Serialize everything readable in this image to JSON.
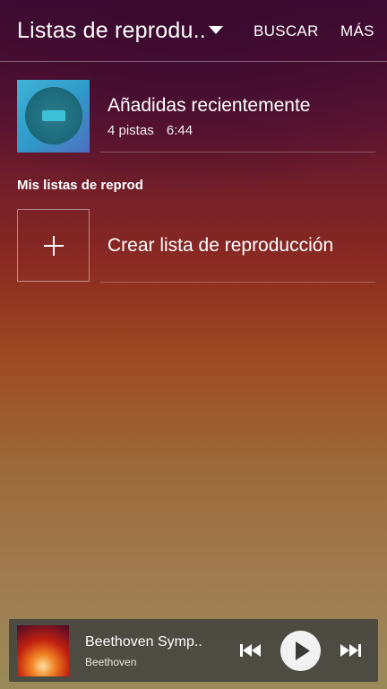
{
  "header": {
    "title": "Listas de reprodu..",
    "actions": [
      "BUSCAR",
      "MÁS"
    ]
  },
  "recent": {
    "title": "Añadidas recientemente",
    "tracks": "4 pistas",
    "duration": "6:44"
  },
  "section_label": "Mis listas de reprod",
  "create": {
    "label": "Crear lista de reproducción"
  },
  "player": {
    "track": "Beethoven Symp..",
    "artist": "Beethoven"
  }
}
